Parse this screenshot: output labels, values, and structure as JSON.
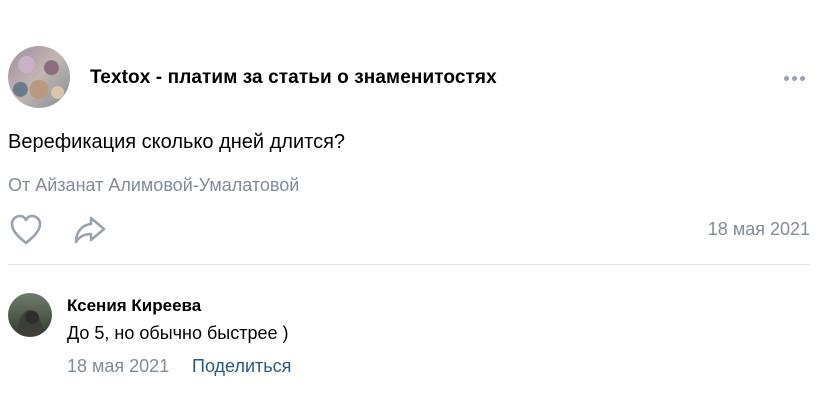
{
  "post": {
    "community_name": "Textox - платим за статьи о знаменитостях",
    "text": "Верефикация сколько дней длится?",
    "author_line": "От Айзанат Алимовой-Умалатовой",
    "date": "18 мая 2021",
    "icons": {
      "like": "heart-icon",
      "share": "share-arrow-icon",
      "more": "more-dots-icon"
    }
  },
  "comment": {
    "author": "Ксения Киреева",
    "text": "До 5, но обычно быстрее )",
    "date": "18 мая 2021",
    "share_label": "Поделиться"
  },
  "colors": {
    "secondary_text": "#818c99",
    "link": "#2a5885",
    "icon": "#99a2ad",
    "divider": "#e1e3e6"
  }
}
